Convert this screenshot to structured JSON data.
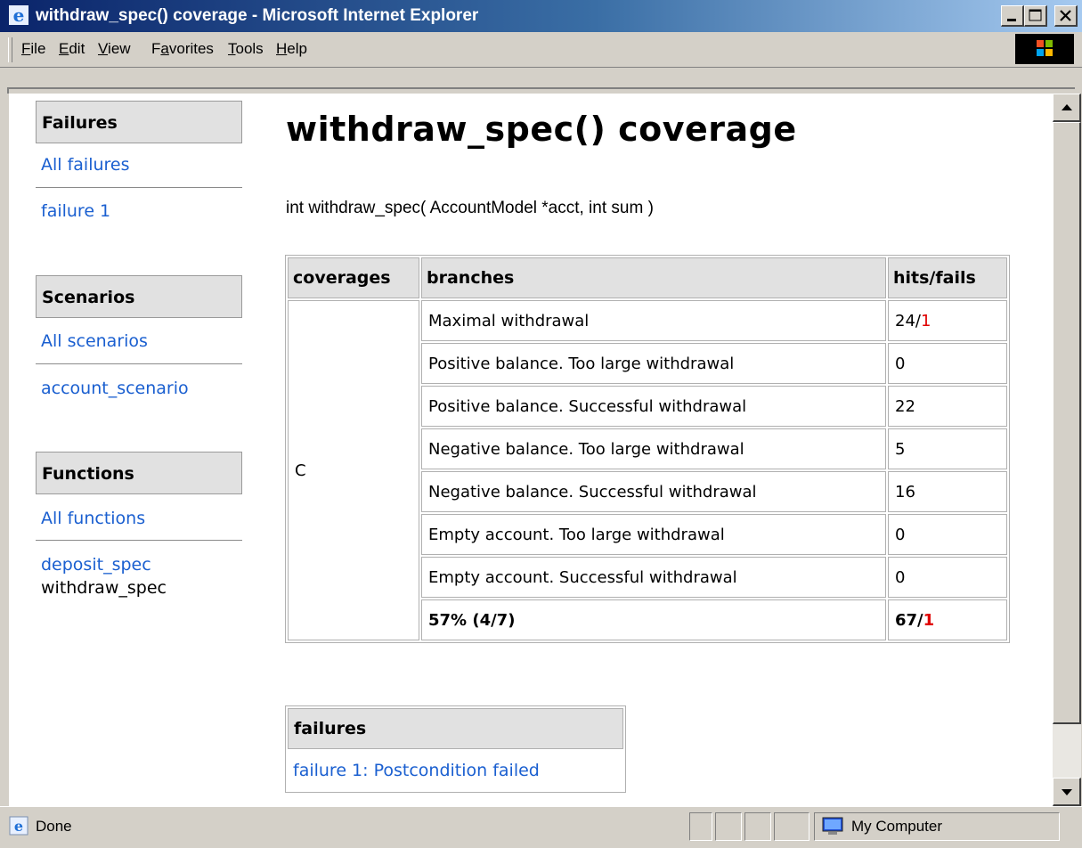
{
  "window": {
    "title": "withdraw_spec() coverage - Microsoft Internet Explorer"
  },
  "menu": [
    {
      "label": "File",
      "accel": "F"
    },
    {
      "label": "Edit",
      "accel": "E"
    },
    {
      "label": "View",
      "accel": "V"
    },
    {
      "label": "Favorites",
      "accel": "a"
    },
    {
      "label": "Tools",
      "accel": "T"
    },
    {
      "label": "Help",
      "accel": "H"
    }
  ],
  "sidebar": {
    "failures": {
      "heading": "Failures",
      "items": [
        "All failures",
        "failure 1"
      ]
    },
    "scenarios": {
      "heading": "Scenarios",
      "items": [
        "All scenarios",
        "account_scenario"
      ]
    },
    "functions": {
      "heading": "Functions",
      "items": [
        "All functions",
        "deposit_spec"
      ],
      "current": "withdraw_spec"
    }
  },
  "main": {
    "title": "withdraw_spec() coverage",
    "signature": "int withdraw_spec( AccountModel *acct, int sum )",
    "coverage_table": {
      "headers": {
        "coverages": "coverages",
        "branches": "branches",
        "hits": "hits/fails"
      },
      "coverage_name": "C",
      "rows": [
        {
          "branch": "Maximal withdrawal",
          "hits": "24/",
          "fails": "1"
        },
        {
          "branch": "Positive balance. Too large withdrawal",
          "hits": "0",
          "fails": ""
        },
        {
          "branch": "Positive balance. Successful withdrawal",
          "hits": "22",
          "fails": ""
        },
        {
          "branch": "Negative balance. Too large withdrawal",
          "hits": "5",
          "fails": ""
        },
        {
          "branch": "Negative balance. Successful withdrawal",
          "hits": "16",
          "fails": ""
        },
        {
          "branch": "Empty account. Too large withdrawal",
          "hits": "0",
          "fails": ""
        },
        {
          "branch": "Empty account. Successful withdrawal",
          "hits": "0",
          "fails": ""
        }
      ],
      "total": {
        "branch": "57% (4/7)",
        "hits": "67/",
        "fails": "1"
      }
    },
    "failures_table": {
      "header": "failures",
      "items": [
        "failure 1: Postcondition failed"
      ]
    }
  },
  "status": {
    "text": "Done",
    "zone": "My Computer"
  },
  "colors": {
    "link": "#1a5fd0",
    "fail": "#e00000",
    "titlebar": "#0a246a"
  }
}
